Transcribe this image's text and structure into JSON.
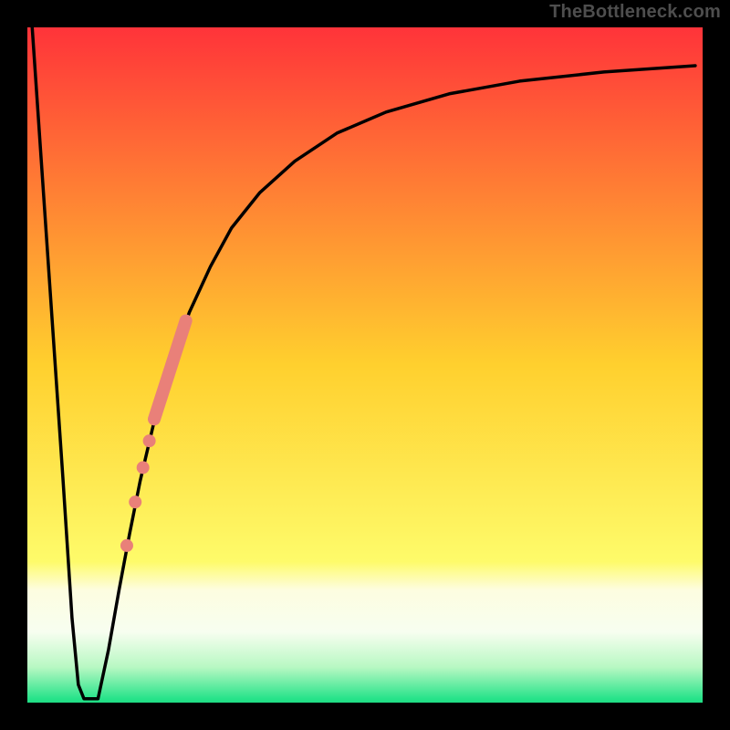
{
  "watermark": "TheBottleneck.com",
  "chart_data": {
    "type": "line",
    "title": "",
    "xlabel": "",
    "ylabel": "",
    "xlim": [
      0,
      100
    ],
    "ylim": [
      0,
      100
    ],
    "gradient_stops": [
      {
        "offset": 0.0,
        "color": "#ff2d3a"
      },
      {
        "offset": 0.5,
        "color": "#ffd02e"
      },
      {
        "offset": 0.78,
        "color": "#fefb6a"
      },
      {
        "offset": 0.82,
        "color": "#fdfde0"
      },
      {
        "offset": 0.88,
        "color": "#f7fef0"
      },
      {
        "offset": 0.93,
        "color": "#b8f8c3"
      },
      {
        "offset": 0.975,
        "color": "#27e38a"
      },
      {
        "offset": 1.0,
        "color": "#07c56f"
      }
    ],
    "series": [
      {
        "name": "curve-left",
        "x": [
          2.5,
          4.0,
          5.5,
          7.0,
          8.3,
          9.2,
          10.0
        ],
        "y": [
          100,
          78,
          56,
          34,
          14,
          4.5,
          2.5
        ]
      },
      {
        "name": "flat-bottom",
        "x": [
          10.0,
          12.0
        ],
        "y": [
          2.5,
          2.5
        ]
      },
      {
        "name": "curve-right",
        "x": [
          12.0,
          13.5,
          15.0,
          16.5,
          18.0,
          20.0,
          22.5,
          25.0,
          28.0,
          31.0,
          35.0,
          40.0,
          46.0,
          53.0,
          62.0,
          72.0,
          84.0,
          97.0
        ],
        "y": [
          2.5,
          9.5,
          18.0,
          26.0,
          33.5,
          42.0,
          50.5,
          57.5,
          64.0,
          69.5,
          74.5,
          79.0,
          83.0,
          86.0,
          88.6,
          90.4,
          91.7,
          92.6
        ]
      }
    ],
    "highlight": {
      "color": "#e98079",
      "segment": {
        "x1": 20.0,
        "y1": 42.3,
        "x2": 24.5,
        "y2": 56.3,
        "width": 14
      },
      "dots": [
        {
          "x": 19.3,
          "y": 39.2,
          "r": 7
        },
        {
          "x": 18.4,
          "y": 35.4,
          "r": 7
        },
        {
          "x": 17.3,
          "y": 30.5,
          "r": 7
        },
        {
          "x": 16.1,
          "y": 24.3,
          "r": 7
        }
      ]
    },
    "frame": {
      "stroke": "#000000",
      "width": 30
    }
  }
}
